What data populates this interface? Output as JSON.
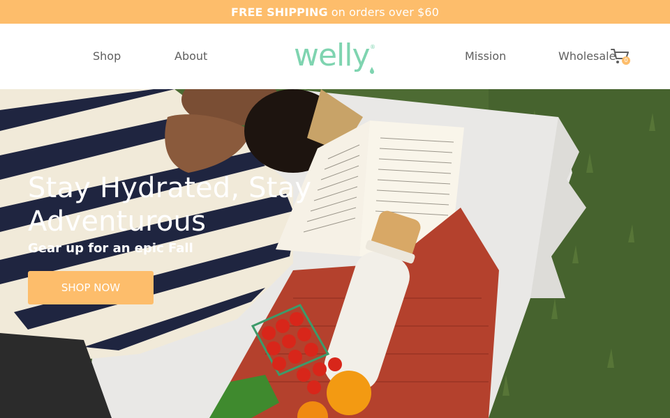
{
  "announcement": {
    "bold": "FREE SHIPPING",
    "rest": "on orders over $60"
  },
  "nav": {
    "shop": "Shop",
    "about": "About",
    "mission": "Mission",
    "wholesale": "Wholesale"
  },
  "logo": {
    "text": "welly",
    "mark": "®"
  },
  "cart": {
    "icon": "shopping-cart-icon",
    "count": "0"
  },
  "hero": {
    "title": "Stay Hydrated, Stay Adventurous",
    "subtitle": "Gear up for an epic Fall",
    "cta": "SHOP NOW"
  },
  "colors": {
    "accent": "#fdbd6b",
    "logo": "#7fd4b0",
    "nav_text": "#5f5f5f"
  }
}
